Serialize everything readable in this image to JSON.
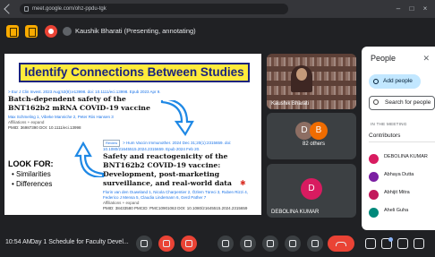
{
  "browser": {
    "url": "meet.google.com/ohz-ppdu-tgk"
  },
  "header": {
    "presenter": "Kaushik Bharati (Presenting, annotating)"
  },
  "slide": {
    "title": "Identify Connections Between Studies",
    "paper1": {
      "citation": "> Eur J Clin Invest. 2023 Aug;53(8):e13998. doi: 10.1111/eci.13998. Epub 2023 Apr 9.",
      "title": "Batch-dependent safety of the BNT162b2 mRNA COVID-19 vaccine",
      "authors": "Max Schmeling 1, Vibeke Manniche 2, Peter Riis Hansen 3",
      "affiliations": "Affiliations + expand",
      "ids": "PMID: 36987390 DOI: 10.1111/eci.13998"
    },
    "paper2": {
      "badge": "Review",
      "citation": "> Hum Vaccin Immunother. 2024 Dec 31;20(1):2315659. doi: 10.1080/21645515.2024.2315659. Epub 2024 Feb 20.",
      "title": "Safety and reactogenicity of the BNT162b2 COVID-19 vaccine: Development, post-marketing surveillance, and real-world data",
      "authors": "Florin van den Ouweland 1, Nicola Charpentier 2, Özlem Türeci 3, Ruben Rizzi 4, Federico J Mensa 5, Claudia Lindemann 6, Gerd Pather 7",
      "affiliations": "Affiliations + expand",
      "ids": "PMID: 38433580 PMCID: PMC10901063 DOI: 10.1080/21645515.2024.2315659"
    },
    "lookfor": {
      "heading": "LOOK FOR:",
      "items": [
        "Similarities",
        "Differences"
      ]
    }
  },
  "tiles": {
    "presenter_name": "Kaushik Bharati",
    "others_count": "82 others",
    "others_avatars": [
      "D",
      "B"
    ],
    "self_initial": "D",
    "self_name": "DEBOLINA KUMAR"
  },
  "people_panel": {
    "title": "People",
    "add_label": "Add people",
    "search_placeholder": "Search for people",
    "section": "IN THE MEETING",
    "contributors_label": "Contributors",
    "participants": [
      {
        "initial": "D",
        "name": "DEBOLINA KUMAR",
        "sub": "",
        "color": "#d81b60"
      },
      {
        "initial": "A",
        "name": "Abhaya Dutta",
        "sub": "",
        "color": "#7b1fa2"
      },
      {
        "initial": "A",
        "name": "Abhijit Mitra",
        "sub": "",
        "color": "#c2185b"
      },
      {
        "initial": "A",
        "name": "Aheli Guha",
        "sub": "",
        "color": "#00897b"
      }
    ]
  },
  "bottom": {
    "time": "10:54 AM",
    "meeting_name": "Day 1 Schedule for Faculty Devel..."
  },
  "colors": {
    "slide_title_bg": "#ffeb3b",
    "slide_title_border": "#1a237e",
    "arrow_blue": "#1e88e5",
    "end_call": "#ea4335",
    "add_people_bg": "#c2e7ff"
  },
  "icons": [
    "lock-icon",
    "back-icon",
    "forward-icon",
    "reload-icon",
    "hand-icon",
    "present-icon",
    "record-icon",
    "mic-off-icon",
    "camera-off-icon",
    "captions-icon",
    "emoji-icon",
    "present-now-icon",
    "raise-hand-icon",
    "more-options-icon",
    "end-call-icon",
    "info-icon",
    "people-icon",
    "chat-icon",
    "activities-icon",
    "lock-host-icon"
  ]
}
